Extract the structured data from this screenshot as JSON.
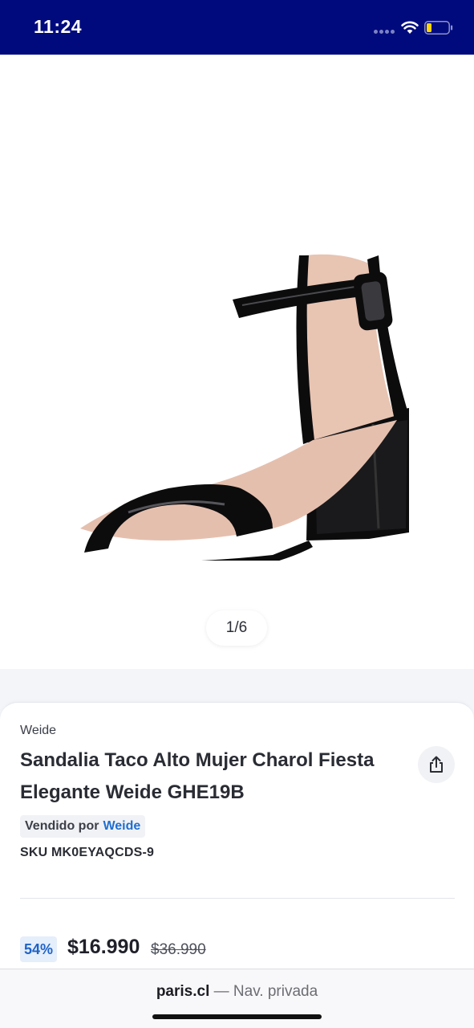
{
  "status_bar": {
    "time": "11:24"
  },
  "gallery": {
    "page_indicator": "1/6",
    "current_image": 1,
    "total_images": 6
  },
  "product": {
    "brand": "Weide",
    "title": "Sandalia Taco Alto Mujer Charol Fiesta Elegante Weide GHE19B",
    "seller_prefix": "Vendido por",
    "seller_name": "Weide",
    "sku": "SKU MK0EYAQCDS-9",
    "discount": "54%",
    "price": "$16.990",
    "old_price": "$36.990"
  },
  "browser": {
    "domain": "paris.cl",
    "separator": "—",
    "mode": "Nav. privada"
  },
  "colors": {
    "status_bar_bg": "#000a7d",
    "seller_link": "#1f6fd1",
    "discount_bg": "#e5eefb",
    "discount_text": "#1f63c6"
  }
}
